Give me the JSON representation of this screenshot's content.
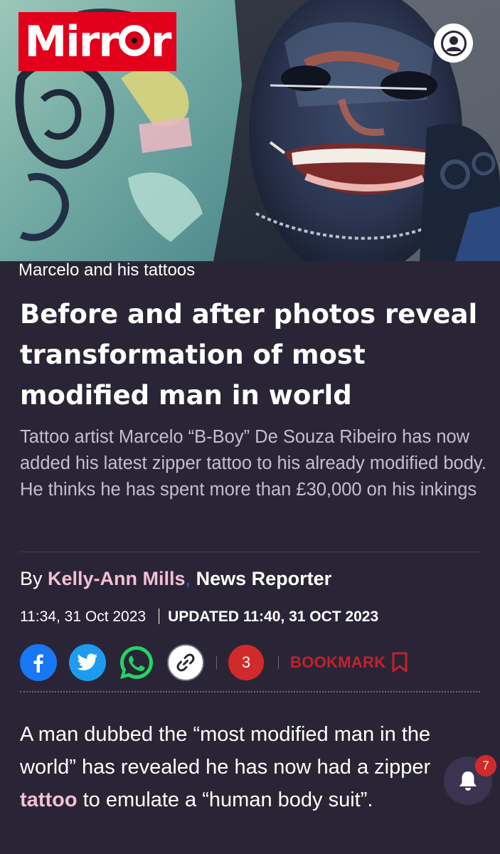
{
  "brand": {
    "name_left": "Mirr",
    "name_right": "r",
    "color": "#e2001a"
  },
  "hero": {
    "icon": "account-icon"
  },
  "article": {
    "image_caption": "Marcelo and his tattoos",
    "headline": "Before and after photos reveal transformation of most modified man in world",
    "standfirst": "Tattoo artist Marcelo “B-Boy” De Souza Ribeiro has now added his latest zipper tattoo to his already modified body. He thinks he has spent more than £30,000 on his inkings",
    "byline_prefix": "By ",
    "author": "Kelly-Ann Mills",
    "author_separator": ",",
    "author_role": "News Reporter",
    "published": "11:34, 31 Oct 2023",
    "updated": "UPDATED 11:40, 31 OCT 2023"
  },
  "share": {
    "icons": [
      "facebook-icon",
      "twitter-icon",
      "whatsapp-icon",
      "link-icon"
    ],
    "comment_count": "3",
    "bookmark_label": "BOOKMARK"
  },
  "body": {
    "paragraph_before_link": "A man dubbed the “most modified man in the world” has revealed he has now had a zipper ",
    "link_text": "tattoo",
    "paragraph_after_link": " to emulate a “human body suit”."
  },
  "notifications": {
    "count": "7",
    "icon": "bell-icon"
  },
  "colors": {
    "background": "#2a2536",
    "accent_pink": "#f4bfd7",
    "bookmark_red": "#c4202e",
    "badge_red": "#d12a2a",
    "facebook": "#1877f2",
    "twitter": "#1d9bf0",
    "whatsapp": "#25d366"
  }
}
